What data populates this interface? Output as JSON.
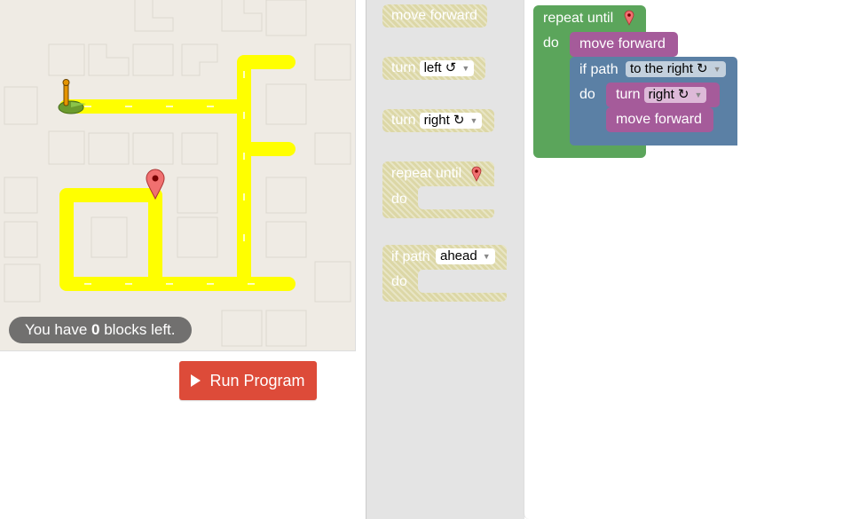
{
  "maze": {
    "status_prefix": "You have ",
    "status_count": "0",
    "status_suffix": " blocks left."
  },
  "run_button": {
    "label": "Run Program"
  },
  "toolbox": {
    "move_forward": "move forward",
    "turn_left": {
      "label": "turn",
      "value": "left ↺"
    },
    "turn_right": {
      "label": "turn",
      "value": "right ↻"
    },
    "repeat_until": {
      "label": "repeat until",
      "do": "do"
    },
    "if_path": {
      "label": "if path",
      "value": "ahead",
      "do": "do"
    }
  },
  "workspace": {
    "repeat_label": "repeat until",
    "repeat_do": "do",
    "move1": "move forward",
    "if_label": "if path",
    "if_value": "to the right ↻",
    "if_do": "do",
    "turn_label": "turn",
    "turn_value": "right ↻",
    "move2": "move forward"
  },
  "colors": {
    "path": "#ffff00",
    "loop_block": "#5ba55b",
    "logic_block": "#5b80a5",
    "movement_block": "#a55b9a",
    "run_button": "#dd4b39"
  }
}
